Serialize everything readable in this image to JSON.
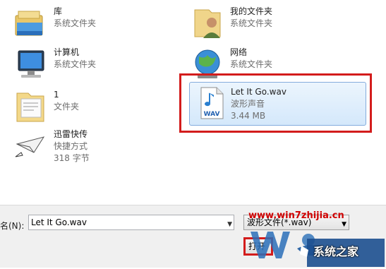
{
  "items": {
    "library": {
      "name": "库",
      "sub": "系统文件夹"
    },
    "my_documents": {
      "name": "我的文件夹",
      "sub": "系统文件夹"
    },
    "computer": {
      "name": "计算机",
      "sub": "系统文件夹"
    },
    "network": {
      "name": "网络",
      "sub": "系统文件夹"
    },
    "folder_1": {
      "name": "1",
      "sub": "文件夹"
    },
    "selected_file": {
      "name": "Let It Go.wav",
      "type": "波形声音",
      "size": "3.44 MB",
      "icon_text": "WAV"
    },
    "xunlei": {
      "name": "迅雷快传",
      "type": "快捷方式",
      "size": "318 字节"
    }
  },
  "bottom_bar": {
    "filename_label": "名(N):",
    "filename_value": "Let It Go.wav",
    "filetype_value": "波形文件(*.wav)",
    "open_button": "打开"
  },
  "watermark": {
    "url": "www.win7zhijia.cn",
    "text": "系统之家"
  }
}
